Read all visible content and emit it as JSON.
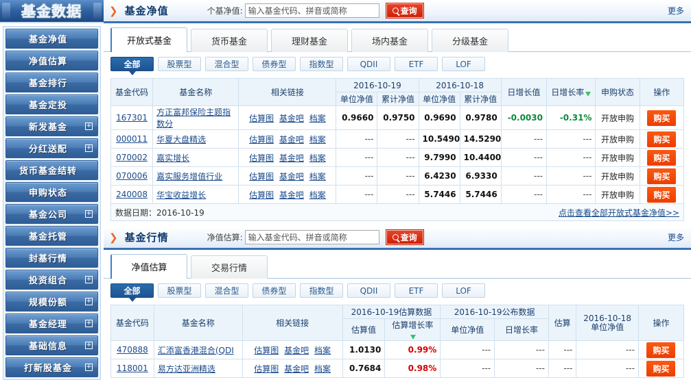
{
  "sidebar": {
    "logo": "基金数据",
    "items": [
      {
        "label": "基金净值",
        "expandable": false
      },
      {
        "label": "净值估算",
        "expandable": false
      },
      {
        "label": "基金排行",
        "expandable": false
      },
      {
        "label": "基金定投",
        "expandable": false
      },
      {
        "label": "新发基金",
        "expandable": true
      },
      {
        "label": "分红送配",
        "expandable": true
      },
      {
        "label": "货币基金结转",
        "expandable": false
      },
      {
        "label": "申购状态",
        "expandable": false
      },
      {
        "label": "基金公司",
        "expandable": true
      },
      {
        "label": "基金托管",
        "expandable": false
      },
      {
        "label": "封基行情",
        "expandable": false
      },
      {
        "label": "投资组合",
        "expandable": true
      },
      {
        "label": "规模份额",
        "expandable": true
      },
      {
        "label": "基金经理",
        "expandable": true
      },
      {
        "label": "基础信息",
        "expandable": true
      },
      {
        "label": "打新股基金",
        "expandable": true
      }
    ],
    "expand_glyph": "+"
  },
  "section1": {
    "arrow": "❯",
    "title": "基金净值",
    "search_label": "个基净值:",
    "search_placeholder": "输入基金代码、拼音或简称",
    "search_value": "",
    "search_button": "查询",
    "more": "更多",
    "tabs": [
      {
        "label": "开放式基金",
        "active": true
      },
      {
        "label": "货币基金",
        "active": false
      },
      {
        "label": "理财基金",
        "active": false
      },
      {
        "label": "场内基金",
        "active": false
      },
      {
        "label": "分级基金",
        "active": false
      }
    ],
    "subtabs": [
      {
        "label": "全部",
        "active": true
      },
      {
        "label": "股票型",
        "active": false
      },
      {
        "label": "混合型",
        "active": false
      },
      {
        "label": "债券型",
        "active": false
      },
      {
        "label": "指数型",
        "active": false
      },
      {
        "label": "QDII",
        "active": false
      },
      {
        "label": "ETF",
        "active": false
      },
      {
        "label": "LOF",
        "active": false
      }
    ],
    "table": {
      "group_headers": {
        "code": "基金代码",
        "name": "基金名称",
        "links": "相关链接",
        "date_a": "2016-10-19",
        "date_b": "2016-10-18",
        "growth_value": "日增长值",
        "growth_rate": "日增长率",
        "purchase_state": "申购状态",
        "op": "操作"
      },
      "sub_headers": {
        "unit_nav_a": "单位净值",
        "acc_nav_a": "累计净值",
        "unit_nav_b": "单位净值",
        "acc_nav_b": "累计净值"
      },
      "link_labels": [
        "估算图",
        "基金吧",
        "档案"
      ],
      "buy_label": "购买",
      "rows": [
        {
          "code": "167301",
          "name": "方正富邦保险主题指数分",
          "unit_a": "0.9660",
          "acc_a": "0.9750",
          "unit_b": "0.9690",
          "acc_b": "0.9780",
          "gval": "-0.0030",
          "grate": "-0.31%",
          "trend": "neg",
          "state": "开放申购"
        },
        {
          "code": "000011",
          "name": "华夏大盘精选",
          "unit_a": "---",
          "acc_a": "---",
          "unit_b": "10.5490",
          "acc_b": "14.5290",
          "gval": "---",
          "grate": "---",
          "trend": "none",
          "state": "开放申购"
        },
        {
          "code": "070002",
          "name": "嘉实增长",
          "unit_a": "---",
          "acc_a": "---",
          "unit_b": "9.7990",
          "acc_b": "10.4400",
          "gval": "---",
          "grate": "---",
          "trend": "none",
          "state": "开放申购"
        },
        {
          "code": "070006",
          "name": "嘉实服务增值行业",
          "unit_a": "---",
          "acc_a": "---",
          "unit_b": "6.4230",
          "acc_b": "6.9330",
          "gval": "---",
          "grate": "---",
          "trend": "none",
          "state": "开放申购"
        },
        {
          "code": "240008",
          "name": "华宝收益增长",
          "unit_a": "---",
          "acc_a": "---",
          "unit_b": "5.7446",
          "acc_b": "5.7446",
          "gval": "---",
          "grate": "---",
          "trend": "none",
          "state": "开放申购"
        }
      ],
      "footer_label": "数据日期：2016-10-19",
      "footer_link": "点击查看全部开放式基金净值>>"
    }
  },
  "section2": {
    "arrow": "❯",
    "title": "基金行情",
    "search_label": "净值估算:",
    "search_placeholder": "输入基金代码、拼音或简称",
    "search_value": "",
    "search_button": "查询",
    "more": "更多",
    "tabs": [
      {
        "label": "净值估算",
        "active": true
      },
      {
        "label": "交易行情",
        "active": false
      }
    ],
    "subtabs": [
      {
        "label": "全部",
        "active": true
      },
      {
        "label": "股票型",
        "active": false
      },
      {
        "label": "混合型",
        "active": false
      },
      {
        "label": "债券型",
        "active": false
      },
      {
        "label": "指数型",
        "active": false
      },
      {
        "label": "QDII",
        "active": false
      },
      {
        "label": "ETF",
        "active": false
      },
      {
        "label": "LOF",
        "active": false
      }
    ],
    "table": {
      "group_headers": {
        "code": "基金代码",
        "name": "基金名称",
        "links": "相关链接",
        "est_group": "2016-10-19估算数据",
        "pub_group": "2016-10-19公布数据",
        "est": "估算",
        "prev_nav": "2016-10-18\n单位净值",
        "prev_nav_line1": "2016-10-18",
        "prev_nav_line2": "单位净值",
        "op": "操作"
      },
      "sub_headers": {
        "est_value": "估算值",
        "est_rate": "估算增长率",
        "unit_nav": "单位净值",
        "day_rate": "日增长率"
      },
      "link_labels": [
        "估算图",
        "基金吧",
        "档案"
      ],
      "buy_label": "购买",
      "rows": [
        {
          "code": "470888",
          "name": "汇添富香港混合(QDI",
          "est_value": "1.0130",
          "est_rate": "0.99%",
          "trend": "pos",
          "unit_nav": "---",
          "day_rate": "---",
          "est": "---",
          "prev_nav": "---"
        },
        {
          "code": "118001",
          "name": "易方达亚洲精选",
          "est_value": "0.7684",
          "est_rate": "0.98%",
          "trend": "pos",
          "unit_nav": "---",
          "day_rate": "---",
          "est": "---",
          "prev_nav": "---"
        }
      ]
    }
  },
  "colors": {
    "brand_blue": "#2f5f9e",
    "accent_orange": "#f26522",
    "buy_red": "#ec3d00",
    "up_red": "#d40000",
    "down_green": "#0a8a3c",
    "link_blue": "#1a4a8c"
  }
}
